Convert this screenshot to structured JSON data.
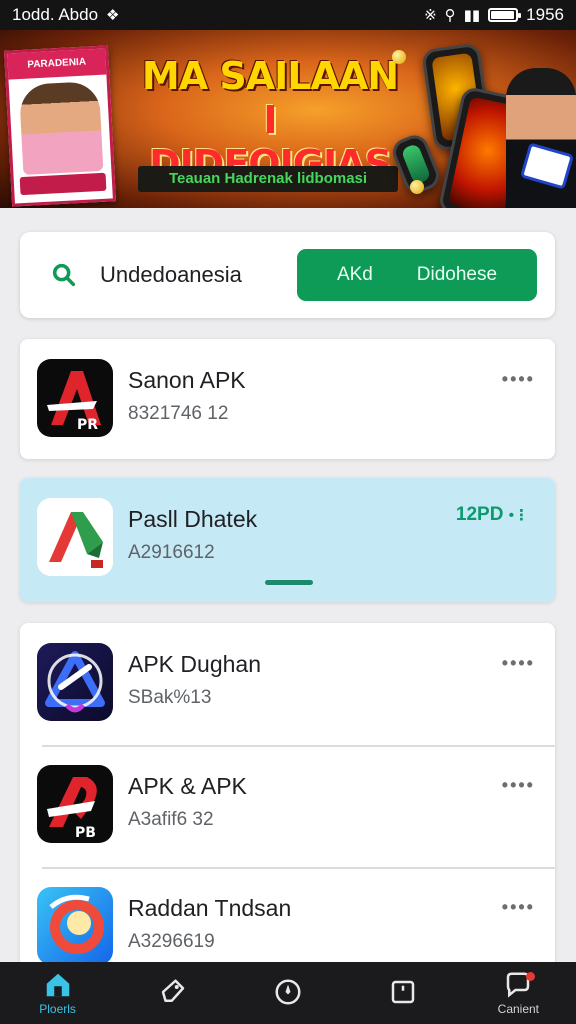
{
  "status_bar": {
    "left_text": "1odd. Abdo",
    "time": "1956",
    "battery_level": 0.95
  },
  "banner": {
    "title_line1": "MA SAILAAN",
    "title_line2": "I DIDEOIGIAS",
    "subtitle": "Teauan Hadrenak lidbomasi",
    "poster_top_text": "PARADENIA"
  },
  "search": {
    "value": "Undedoanesia",
    "button_left": "AKd",
    "button_right": "Didohese"
  },
  "apps": [
    {
      "name": "Sanon APK",
      "size": "8321746 12",
      "action": "more",
      "icon": "red-a-icon"
    },
    {
      "name": "Pasll Dhatek",
      "size": "A2916612",
      "badge": "12PD",
      "action": "badge",
      "icon": "green-red-arrow-icon"
    },
    {
      "name": "APK Dughan",
      "size": "SBak%13",
      "action": "more",
      "icon": "blue-triangle-icon"
    },
    {
      "name": "APK & APK",
      "size": "A3afif6 32",
      "action": "more",
      "icon": "red-a-icon"
    },
    {
      "name": "Raddan Tndsan",
      "size": "A3296619",
      "action": "more",
      "icon": "blue-swirl-icon"
    }
  ],
  "more_label": "••••",
  "bottom_nav": [
    {
      "label": "Ploerls",
      "icon": "home-icon",
      "active": true
    },
    {
      "label": "",
      "icon": "tag-icon",
      "active": false
    },
    {
      "label": "",
      "icon": "compass-icon",
      "active": false
    },
    {
      "label": "",
      "icon": "square-icon",
      "active": false
    },
    {
      "label": "Canient",
      "icon": "chat-icon",
      "active": false
    }
  ],
  "colors": {
    "accent_green": "#0d9b57",
    "highlight_blue": "#c5e9f5",
    "nav_active": "#39c3e6"
  }
}
